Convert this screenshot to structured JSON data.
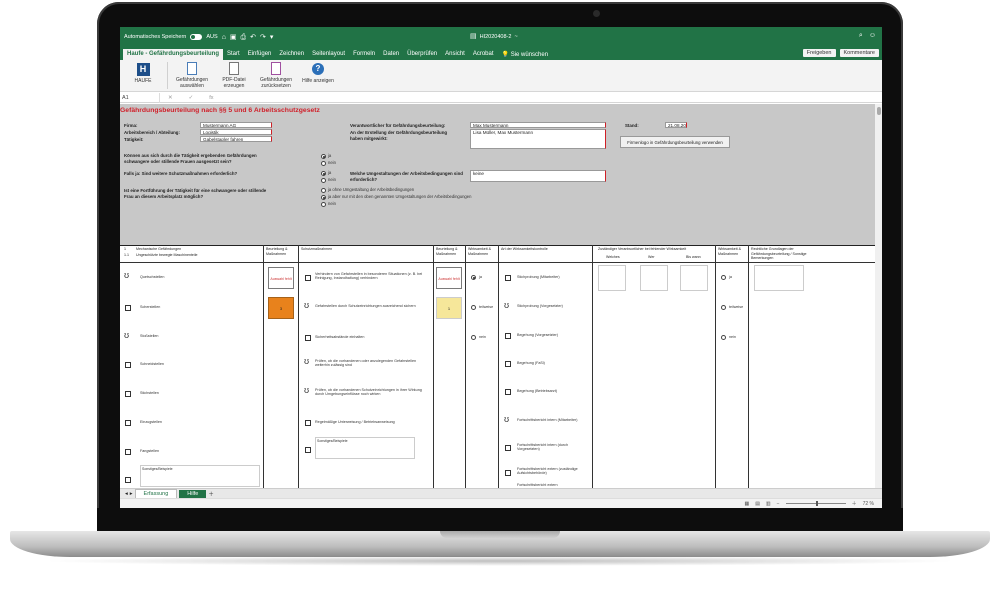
{
  "titlebar": {
    "autosave_label": "Automatisches Speichern",
    "autosave_state": "AUS",
    "doc_title": "HI2020408-2",
    "doc_title_suffix": "~"
  },
  "tabs": [
    "Haufe - Gefährdungsbeurteilung",
    "Start",
    "Einfügen",
    "Zeichnen",
    "Seitenlayout",
    "Formeln",
    "Daten",
    "Überprüfen",
    "Ansicht",
    "Acrobat",
    "Sie wünschen"
  ],
  "share": {
    "freigeben": "Freigeben",
    "kommentare": "Kommentare"
  },
  "ribbon": [
    {
      "label": "HAUFE"
    },
    {
      "label": "Gefährdungen auswählen"
    },
    {
      "label": "PDF-Datei erzeugen"
    },
    {
      "label": "Gefährdungen zurücksetzen"
    },
    {
      "label": "Hilfe anzeigen"
    }
  ],
  "formula": {
    "cell": "A1",
    "fx": "fx"
  },
  "sheet": {
    "title": "Gefährdungsbeurteilung nach §§ 5 und 6 Arbeitsschutzgesetz",
    "firma_label": "Firma:",
    "firma_value": "Mustermann AG",
    "arbeitsbereich_label": "Arbeitsbereich / Abteilung:",
    "arbeitsbereich_value": "Logistik",
    "taetigkeit_label": "Tätigkeit:",
    "taetigkeit_value": "Gabelstapler fahren",
    "verantwortlich_label": "Verantwortlicher für Gefährdungsbeurteilung:",
    "verantwortlich_value": "Max Mustermann",
    "erstellung_label": "An der Erstellung der Gefährdungsbeurteilung haben mitgewirkt:",
    "erstellung_value": "Lisa Müller, Max Mustermann",
    "stand_label": "Stand:",
    "stand_value": "21.08.20",
    "button_label": "Firmenlogo in Gefährdungsbeurteilung verwenden",
    "q1": "Können aus sich durch die Tätigkeit ergebenden Gefährdungen schwangere oder stillende Frauen ausgesetzt sein?",
    "q2": "Falls ja: Sind weitere Schutzmaßnahmen erforderlich?",
    "q3": "Welche Umgestaltungen der Arbeitsbedingungen sind erforderlich?",
    "q3_value": "keine",
    "q4": "Ist eine Fortführung der Tätigkeit für eine schwangere oder stillende Frau an diesem Arbeitsplatz möglich?",
    "opt_ja": "ja",
    "opt_nein": "nein",
    "opt_a": "ja ohne Umgestaltung der Arbeitsbedingungen",
    "opt_b": "ja aber nur mit den oben genannten Umgestaltungen der Arbeitsbedingungen",
    "opt_c": "nein"
  },
  "table": {
    "headers": {
      "nr": "1",
      "nr2": "1.1",
      "gefaehrdung": "Mechanische Gefährdungen",
      "gefaehrdung2": "Ungeschützte bewegte Maschinenteile",
      "bewertung": "Beurteilung & Maßnahmen",
      "schutz": "Schutzmaßnahmen",
      "bewertung2": "Beurteilung & Maßnahmen",
      "wirksam": "Wirksamkeit & Maßnahmen",
      "artwirk": "Art der Wirksamkeitskontrolle",
      "zustaendig": "Zuständiger Verantwortlicher bei fehlender Wirksamkeit",
      "welches": "Welches",
      "wer": "Wer",
      "bis_wann": "Bis wann",
      "wirk2": "Wirksamkeit & Maßnahmen",
      "rechtl": "Rechtliche Grundlagen der Gefährdungsbeurteilung / Sonstige Bemerkungen"
    },
    "rows_left": [
      "Quetschstellen",
      "Scherstellen",
      "Stoßstellen",
      "Schneidstellen",
      "Stichstellen",
      "Einzugstellen",
      "Fangstellen"
    ],
    "rows_schutz": [
      "Verhindern von Gefahrstellen in besonderen Situationen (z. B. bei Reinigung, Instandhaltung) verhindern",
      "Gefahrstellen durch Schutzeinrichtungen ausreichend sichern",
      "Sicherheitsabstände einhalten",
      "Prüfen, ob die vorhandenen oder anzulegenden Gefahrstellen weiterhin zulässig sind",
      "Prüfen, ob die vorhandenen Schutzeinrichtungen in ihrer Wirkung durch Umgebungseinflüsse noch wirken",
      "Regelmäßige Unterweisung / Betriebsanweisung"
    ],
    "rows_kontrolle": [
      "Stichprobung (Mitarbeiter)",
      "Stichprobung (Vorgesetzter)",
      "Begehung (Vorgesetzter)",
      "Begehung (FaSi)",
      "Begehung (Betriebsarzt)",
      "Fortschrittsbericht intern (Mitarbeiter)",
      "Fortschrittsbericht intern (durch Vorgesetzten)",
      "Fortschrittsbericht extern (zuständige Aufsichtsbehörde)",
      "Fortschrittsbericht extern"
    ],
    "wirk_opts": [
      "ja",
      "teilweise",
      "nein"
    ],
    "status_red": "Auswahl fehlt",
    "orange_val": "3",
    "yellow_val": "1",
    "note_label": "Sonstiges/Beispiele"
  },
  "sheet_tabs": [
    "Erfassung",
    "Hilfe"
  ],
  "status": {
    "zoom": "72 %"
  }
}
